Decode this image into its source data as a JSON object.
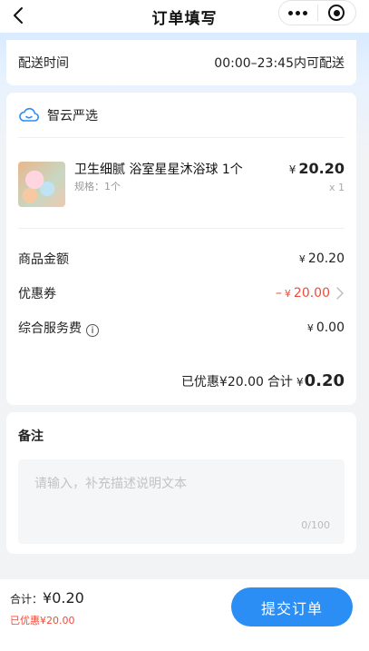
{
  "nav": {
    "title": "订单填写",
    "back_icon": "chevron-left-icon",
    "more_icon": "more-dots-icon",
    "close_icon": "target-circle-icon"
  },
  "delivery": {
    "label": "配送时间",
    "value": "00:00–23:45内可配送"
  },
  "shop": {
    "name": "智云严选",
    "icon": "cloud-icon"
  },
  "product": {
    "name": "卫生细腻 浴室星星沐浴球 1个",
    "spec": "规格：1个",
    "price_symbol": "¥",
    "price": "20.20",
    "qty": "x 1"
  },
  "fees": {
    "goods_label": "商品金额",
    "goods_symbol": "¥",
    "goods_value": "20.20",
    "coupon_label": "优惠券",
    "coupon_prefix": "–",
    "coupon_symbol": "¥",
    "coupon_value": "20.00",
    "service_label": "综合服务费",
    "service_info": "i",
    "service_symbol": "¥",
    "service_value": "0.00"
  },
  "summary": {
    "discount_text": "已优惠¥20.00",
    "total_label": "合计",
    "total_symbol": "¥",
    "total_value": "0.20"
  },
  "note": {
    "title": "备注",
    "placeholder": "请输入，补充描述说明文本",
    "counter": "0/100"
  },
  "bottom": {
    "total_label": "合计：",
    "total_value": "¥0.20",
    "discount": "已优惠¥20.00",
    "submit_label": "提交订单"
  },
  "colors": {
    "accent": "#2b8ef5",
    "discount_red": "#f04b3a",
    "background": "#f2f3f5"
  }
}
